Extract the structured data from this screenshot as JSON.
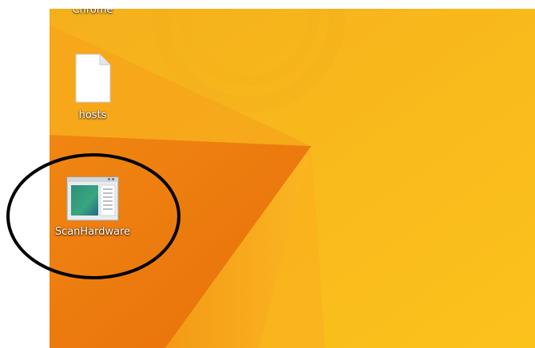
{
  "desktop": {
    "icons": [
      {
        "label": "Chrome",
        "icon": "chrome-shortcut-icon"
      },
      {
        "label": "hosts",
        "icon": "blank-file-icon"
      },
      {
        "label": "ScanHardware",
        "icon": "app-window-icon"
      }
    ]
  },
  "colors": {
    "wallpaper_yellow": "#f8b81a",
    "wallpaper_orange": "#ef7a0e",
    "annotation": "#000000"
  }
}
